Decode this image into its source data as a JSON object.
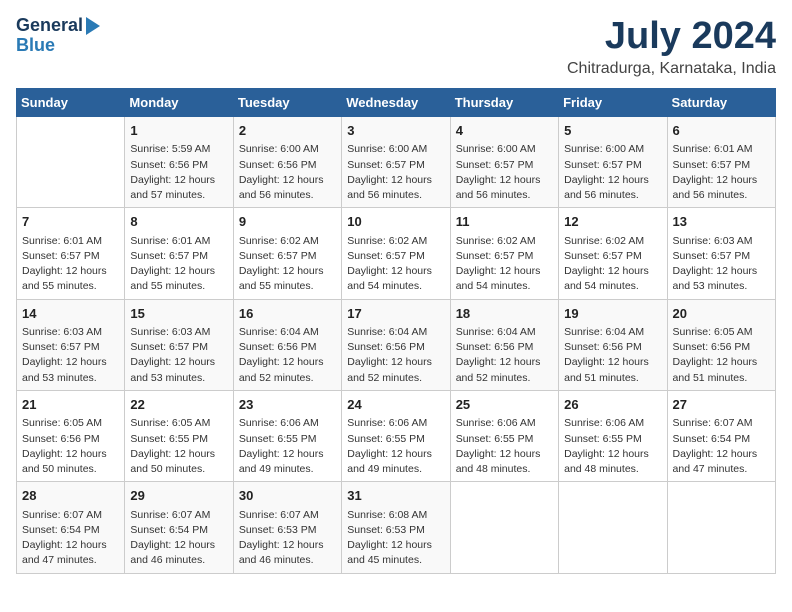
{
  "logo": {
    "line1": "General",
    "line2": "Blue"
  },
  "title": "July 2024",
  "location": "Chitradurga, Karnataka, India",
  "days_of_week": [
    "Sunday",
    "Monday",
    "Tuesday",
    "Wednesday",
    "Thursday",
    "Friday",
    "Saturday"
  ],
  "weeks": [
    [
      {
        "day": "",
        "text": ""
      },
      {
        "day": "1",
        "text": "Sunrise: 5:59 AM\nSunset: 6:56 PM\nDaylight: 12 hours\nand 57 minutes."
      },
      {
        "day": "2",
        "text": "Sunrise: 6:00 AM\nSunset: 6:56 PM\nDaylight: 12 hours\nand 56 minutes."
      },
      {
        "day": "3",
        "text": "Sunrise: 6:00 AM\nSunset: 6:57 PM\nDaylight: 12 hours\nand 56 minutes."
      },
      {
        "day": "4",
        "text": "Sunrise: 6:00 AM\nSunset: 6:57 PM\nDaylight: 12 hours\nand 56 minutes."
      },
      {
        "day": "5",
        "text": "Sunrise: 6:00 AM\nSunset: 6:57 PM\nDaylight: 12 hours\nand 56 minutes."
      },
      {
        "day": "6",
        "text": "Sunrise: 6:01 AM\nSunset: 6:57 PM\nDaylight: 12 hours\nand 56 minutes."
      }
    ],
    [
      {
        "day": "7",
        "text": "Sunrise: 6:01 AM\nSunset: 6:57 PM\nDaylight: 12 hours\nand 55 minutes."
      },
      {
        "day": "8",
        "text": "Sunrise: 6:01 AM\nSunset: 6:57 PM\nDaylight: 12 hours\nand 55 minutes."
      },
      {
        "day": "9",
        "text": "Sunrise: 6:02 AM\nSunset: 6:57 PM\nDaylight: 12 hours\nand 55 minutes."
      },
      {
        "day": "10",
        "text": "Sunrise: 6:02 AM\nSunset: 6:57 PM\nDaylight: 12 hours\nand 54 minutes."
      },
      {
        "day": "11",
        "text": "Sunrise: 6:02 AM\nSunset: 6:57 PM\nDaylight: 12 hours\nand 54 minutes."
      },
      {
        "day": "12",
        "text": "Sunrise: 6:02 AM\nSunset: 6:57 PM\nDaylight: 12 hours\nand 54 minutes."
      },
      {
        "day": "13",
        "text": "Sunrise: 6:03 AM\nSunset: 6:57 PM\nDaylight: 12 hours\nand 53 minutes."
      }
    ],
    [
      {
        "day": "14",
        "text": "Sunrise: 6:03 AM\nSunset: 6:57 PM\nDaylight: 12 hours\nand 53 minutes."
      },
      {
        "day": "15",
        "text": "Sunrise: 6:03 AM\nSunset: 6:57 PM\nDaylight: 12 hours\nand 53 minutes."
      },
      {
        "day": "16",
        "text": "Sunrise: 6:04 AM\nSunset: 6:56 PM\nDaylight: 12 hours\nand 52 minutes."
      },
      {
        "day": "17",
        "text": "Sunrise: 6:04 AM\nSunset: 6:56 PM\nDaylight: 12 hours\nand 52 minutes."
      },
      {
        "day": "18",
        "text": "Sunrise: 6:04 AM\nSunset: 6:56 PM\nDaylight: 12 hours\nand 52 minutes."
      },
      {
        "day": "19",
        "text": "Sunrise: 6:04 AM\nSunset: 6:56 PM\nDaylight: 12 hours\nand 51 minutes."
      },
      {
        "day": "20",
        "text": "Sunrise: 6:05 AM\nSunset: 6:56 PM\nDaylight: 12 hours\nand 51 minutes."
      }
    ],
    [
      {
        "day": "21",
        "text": "Sunrise: 6:05 AM\nSunset: 6:56 PM\nDaylight: 12 hours\nand 50 minutes."
      },
      {
        "day": "22",
        "text": "Sunrise: 6:05 AM\nSunset: 6:55 PM\nDaylight: 12 hours\nand 50 minutes."
      },
      {
        "day": "23",
        "text": "Sunrise: 6:06 AM\nSunset: 6:55 PM\nDaylight: 12 hours\nand 49 minutes."
      },
      {
        "day": "24",
        "text": "Sunrise: 6:06 AM\nSunset: 6:55 PM\nDaylight: 12 hours\nand 49 minutes."
      },
      {
        "day": "25",
        "text": "Sunrise: 6:06 AM\nSunset: 6:55 PM\nDaylight: 12 hours\nand 48 minutes."
      },
      {
        "day": "26",
        "text": "Sunrise: 6:06 AM\nSunset: 6:55 PM\nDaylight: 12 hours\nand 48 minutes."
      },
      {
        "day": "27",
        "text": "Sunrise: 6:07 AM\nSunset: 6:54 PM\nDaylight: 12 hours\nand 47 minutes."
      }
    ],
    [
      {
        "day": "28",
        "text": "Sunrise: 6:07 AM\nSunset: 6:54 PM\nDaylight: 12 hours\nand 47 minutes."
      },
      {
        "day": "29",
        "text": "Sunrise: 6:07 AM\nSunset: 6:54 PM\nDaylight: 12 hours\nand 46 minutes."
      },
      {
        "day": "30",
        "text": "Sunrise: 6:07 AM\nSunset: 6:53 PM\nDaylight: 12 hours\nand 46 minutes."
      },
      {
        "day": "31",
        "text": "Sunrise: 6:08 AM\nSunset: 6:53 PM\nDaylight: 12 hours\nand 45 minutes."
      },
      {
        "day": "",
        "text": ""
      },
      {
        "day": "",
        "text": ""
      },
      {
        "day": "",
        "text": ""
      }
    ]
  ]
}
